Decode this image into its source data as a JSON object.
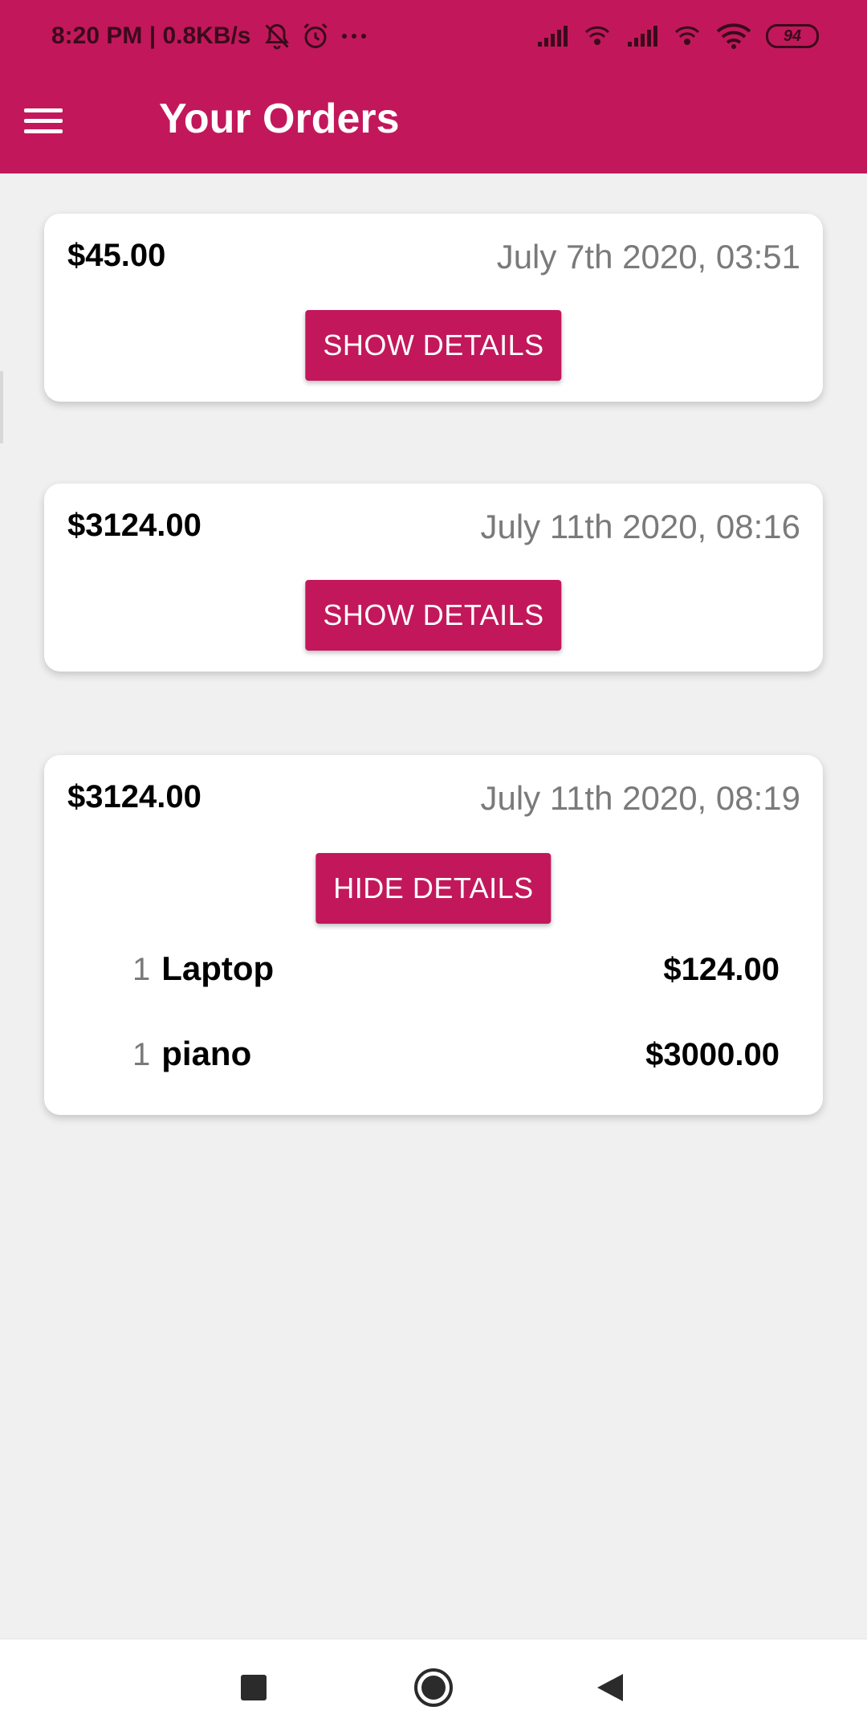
{
  "status_bar": {
    "time_speed": "8:20 PM | 0.8KB/s",
    "battery": "94",
    "icons": [
      "mute-bell-icon",
      "alarm-icon",
      "more-dots-icon",
      "signal-icon",
      "wifi-hotspot-icon",
      "signal-icon",
      "wifi-hotspot-icon",
      "wifi-icon",
      "battery-icon"
    ]
  },
  "app_bar": {
    "title": "Your Orders",
    "menu_icon": "menu-icon"
  },
  "orders": [
    {
      "total": "$45.00",
      "date": "July 7th 2020, 03:51",
      "button_label": "SHOW DETAILS",
      "expanded": false,
      "items": []
    },
    {
      "total": "$3124.00",
      "date": "July 11th 2020, 08:16",
      "button_label": "SHOW DETAILS",
      "expanded": false,
      "items": []
    },
    {
      "total": "$3124.00",
      "date": "July 11th 2020, 08:19",
      "button_label": "HIDE DETAILS",
      "expanded": true,
      "items": [
        {
          "qty": "1",
          "name": "Laptop",
          "price": "$124.00"
        },
        {
          "qty": "1",
          "name": "piano",
          "price": "$3000.00"
        }
      ]
    }
  ],
  "nav_bar": {
    "buttons": [
      "recents-square-icon",
      "home-circle-icon",
      "back-triangle-icon"
    ]
  },
  "colors": {
    "accent": "#c2185b",
    "background": "#f0f0f0",
    "card": "#ffffff",
    "secondary_text": "#7a7a7a"
  }
}
